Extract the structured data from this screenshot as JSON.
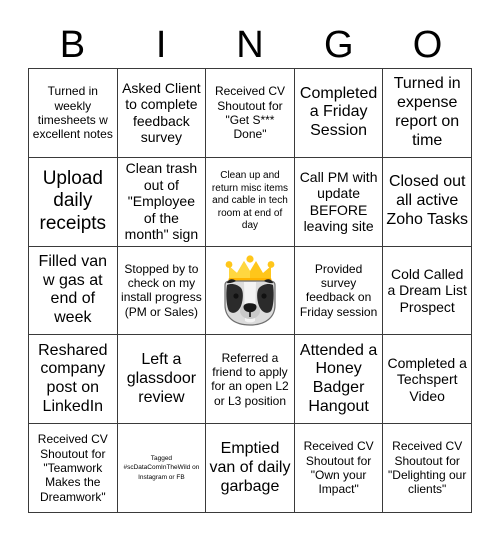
{
  "header": {
    "letters": [
      "B",
      "I",
      "N",
      "G",
      "O"
    ]
  },
  "colors": {
    "grid_line": "#3a3a3a",
    "text": "#000000",
    "background": "#ffffff",
    "crown_gold": "#FFC61A",
    "crown_gold_light": "#FFD740",
    "badger_dark": "#2b2b2b",
    "badger_light": "#d8d8d8",
    "badger_mid": "#8e8e8e"
  },
  "grid": {
    "rows": [
      [
        {
          "text": "Turned in weekly timesheets w excellent notes",
          "size": "sm"
        },
        {
          "text": "Asked Client to complete feedback survey",
          "size": "md"
        },
        {
          "text": "Received CV Shoutout for \"Get S*** Done\"",
          "size": "sm"
        },
        {
          "text": "Completed a Friday Session",
          "size": "lg"
        },
        {
          "text": "Turned in expense report on time",
          "size": "lg"
        }
      ],
      [
        {
          "text": "Upload daily receipts",
          "size": "xl"
        },
        {
          "text": "Clean trash out of \"Employee of the month\" sign",
          "size": "md"
        },
        {
          "text": "Clean up and return misc items and cable in tech room at end of day",
          "size": "xs"
        },
        {
          "text": "Call PM with update BEFORE leaving site",
          "size": "md"
        },
        {
          "text": "Closed out all active Zoho Tasks",
          "size": "lg"
        }
      ],
      [
        {
          "text": "Filled van w gas at end of week",
          "size": "lg"
        },
        {
          "text": "Stopped by to check on my install progress (PM or Sales)",
          "size": "sm"
        },
        {
          "text": "",
          "size": "md",
          "icon": "badger-with-crown-mascot"
        },
        {
          "text": "Provided survey feedback on Friday session",
          "size": "sm"
        },
        {
          "text": "Cold Called a Dream List Prospect",
          "size": "md"
        }
      ],
      [
        {
          "text": "Reshared company post on LinkedIn",
          "size": "lg"
        },
        {
          "text": "Left a glassdoor review",
          "size": "lg"
        },
        {
          "text": "Referred a friend to apply for an open L2 or L3 position",
          "size": "sm"
        },
        {
          "text": "Attended a Honey Badger Hangout",
          "size": "lg"
        },
        {
          "text": "Completed a Techspert Video",
          "size": "md"
        }
      ],
      [
        {
          "text": "Received CV Shoutout for \"Teamwork Makes the Dreamwork\"",
          "size": "sm"
        },
        {
          "text": "Tagged #scDataComInTheWild on Instagram or FB",
          "size": "xxs"
        },
        {
          "text": "Emptied van of daily garbage",
          "size": "lg"
        },
        {
          "text": "Received CV Shoutout for \"Own your Impact\"",
          "size": "sm"
        },
        {
          "text": "Received CV Shoutout for \"Delighting our clients\"",
          "size": "sm"
        }
      ]
    ]
  }
}
